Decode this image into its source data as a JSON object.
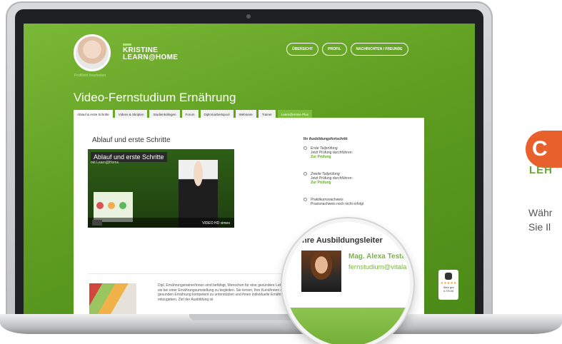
{
  "profile": {
    "name_line1": "KRISTINE",
    "name_line2": "LEARN@HOME",
    "edit_link": "Profilbild bearbeiten"
  },
  "top_nav": [
    "ÜBERSICHT",
    "PROFIL",
    "NACHRICHTEN / FREUNDE"
  ],
  "page_title": "Video-Fernstudium Ernährung",
  "tabs": [
    "Ablauf & erste Schritte",
    "Videos & Skripten",
    "Studienkollegen",
    "Forum",
    "Diplomarbeitspool",
    "Webinare",
    "Trainer",
    "Learn@Home Plus"
  ],
  "main": {
    "section_heading": "Ablauf und erste Schritte",
    "video_title": "Ablauf und erste Schritte",
    "video_sub": "mit Learn@Home",
    "video_brand": "VIDEO HD vimeo",
    "description": "Dipl. Ernährungstrainer/innen sind befähigt, Menschen für eine gesündere Lebensweise zu begeistern und sie bei einer Ernährungsumstellung zu begleiten. Sie lernen, Ihre Kund/innen auf dem Weg zu einer gesunden Ernährung kompetent zu unterstützen und ihnen individuelle Ernährungsempfehlungen mitzugeben. Ziel der Ausbildung ist"
  },
  "progress": {
    "heading": "Ihr Ausbildungsfortschritt",
    "steps": [
      {
        "title": "Erste Teilprüfung",
        "text": "Jetzt Prüfung durchführen:",
        "link": "Zur Prüfung"
      },
      {
        "title": "Zweite Teilprüfung",
        "text": "Jetzt Prüfung durchführen:",
        "link": "Zur Prüfung"
      },
      {
        "title": "Praktikumsnachweis",
        "text": "Praxisnachweis noch nicht erfolgt",
        "link": ""
      }
    ]
  },
  "magnifier": {
    "heading": "Ihre Ausbildungsleiter",
    "name": "Mag. Alexa Testa",
    "email": "fernstudium@vitala"
  },
  "trust_badge": {
    "label": "Sehr gut",
    "score": "4.7/5.00"
  },
  "right_panel": {
    "badge_letter": "C",
    "heading": "LEH",
    "line1": "Währ",
    "line2": "Sie Il"
  }
}
